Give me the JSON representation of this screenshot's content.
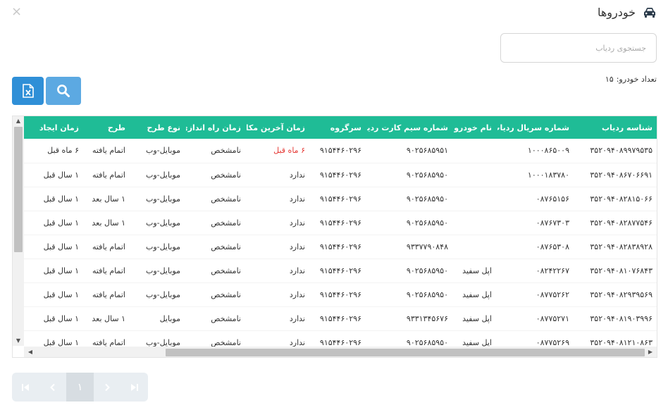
{
  "window": {
    "close_label": "×",
    "title": "خودروها"
  },
  "search": {
    "placeholder": "جستجوی ردیاب",
    "value": ""
  },
  "summary": {
    "count_label": "تعداد خودرو:",
    "count_value": "۱۵"
  },
  "icons": {
    "title": "car-icon",
    "excel": "excel-file-icon",
    "search": "magnifier-icon"
  },
  "colors": {
    "header_bg": "#1fbc96",
    "excel_button": "#2f8fd7",
    "search_button": "#5ca9e2",
    "alert_text": "#e53935"
  },
  "table": {
    "columns": [
      "شناسه ردیاب",
      "شماره سریال ردیاب",
      "نام خودرو",
      "شماره سیم کارت ردیاب",
      "سرگروه",
      "زمان آخرین مکان",
      "زمان راه اندازی",
      "نوع طرح",
      "طرح",
      "زمان ایجاد"
    ],
    "rows": [
      [
        "۳۵۲۰۹۴۰۸۹۹۷۹۵۳۵",
        "۱۰۰۰۸۶۵۰۰۹",
        "",
        "۹۰۲۵۶۸۵۹۵۱",
        "۹۱۵۴۴۶۰۲۹۶",
        "۶ ماه قبل",
        "نامشخص",
        "موبایل-وب",
        "اتمام یافته",
        "۶ ماه قبل"
      ],
      [
        "۳۵۲۰۹۴۰۸۶۷۰۶۶۹۱",
        "۱۰۰۰۱۸۳۷۸۰",
        "",
        "۹۰۲۵۶۸۵۹۵۰",
        "۹۱۵۴۴۶۰۲۹۶",
        "ندارد",
        "نامشخص",
        "موبایل-وب",
        "اتمام یافته",
        "۱ سال قبل"
      ],
      [
        "۳۵۲۰۹۴۰۸۲۸۱۵۰۶۶",
        "۰۸۷۶۵۱۵۶",
        "",
        "۹۰۲۵۶۸۵۹۵۰",
        "۹۱۵۴۴۶۰۲۹۶",
        "ندارد",
        "نامشخص",
        "موبایل-وب",
        "۱ سال بعد",
        "۱ سال قبل"
      ],
      [
        "۳۵۲۰۹۴۰۸۲۸۷۷۵۴۶",
        "۰۸۷۶۷۳۰۳",
        "",
        "۹۰۲۵۶۸۵۹۵۰",
        "۹۱۵۴۴۶۰۲۹۶",
        "ندارد",
        "نامشخص",
        "موبایل-وب",
        "۱ سال بعد",
        "۱ سال قبل"
      ],
      [
        "۳۵۲۰۹۴۰۸۲۸۳۸۹۲۸",
        "۰۸۷۶۵۳۰۸",
        "",
        "۹۳۳۷۷۹۰۸۴۸",
        "۹۱۵۴۴۶۰۲۹۶",
        "ندارد",
        "نامشخص",
        "موبایل-وب",
        "اتمام یافته",
        "۱ سال قبل"
      ],
      [
        "۳۵۲۰۹۴۰۸۱۰۷۶۸۴۳",
        "۰۸۲۴۲۲۶۷",
        "اپل سفید",
        "۹۰۲۵۶۸۵۹۵۰",
        "۹۱۵۴۴۶۰۲۹۶",
        "ندارد",
        "نامشخص",
        "موبایل-وب",
        "اتمام یافته",
        "۱ سال قبل"
      ],
      [
        "۳۵۲۰۹۴۰۸۲۹۳۹۵۶۹",
        "۰۸۷۷۵۲۶۲",
        "اپل سفید",
        "۹۰۲۵۶۸۵۹۵۰",
        "۹۱۵۴۴۶۰۲۹۶",
        "ندارد",
        "نامشخص",
        "موبایل-وب",
        "اتمام یافته",
        "۱ سال قبل"
      ],
      [
        "۳۵۲۰۹۴۰۸۱۹۰۳۹۹۶",
        "۰۸۷۷۵۲۷۱",
        "اپل سفید",
        "۹۳۳۱۳۴۵۶۷۶",
        "۹۱۵۴۴۶۰۲۹۶",
        "ندارد",
        "نامشخص",
        "موبایل",
        "۱ سال بعد",
        "۱ سال قبل"
      ],
      [
        "۳۵۲۰۹۴۰۸۱۲۱۰۸۶۳",
        "۰۸۷۷۵۲۶۹",
        "اپل سفید",
        "۹۰۲۵۶۸۵۹۵۰",
        "۹۱۵۴۴۶۰۲۹۶",
        "ندارد",
        "نامشخص",
        "موبایل-وب",
        "اتمام یافته",
        "۱ سال قبل"
      ]
    ],
    "highlight_value": "۶ ماه قبل"
  },
  "pager": {
    "current_page": "۱"
  }
}
